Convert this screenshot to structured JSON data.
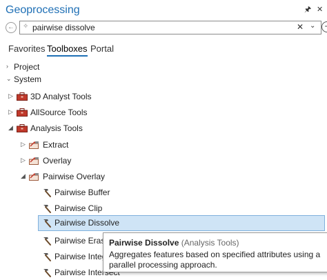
{
  "window": {
    "title": "Geoprocessing"
  },
  "search": {
    "value": "pairwise dissolve"
  },
  "tabs": [
    {
      "label": "Favorites"
    },
    {
      "label": "Toolboxes"
    },
    {
      "label": "Portal"
    }
  ],
  "tree": {
    "project": "Project",
    "system": "System",
    "toolboxes": [
      {
        "label": "3D Analyst Tools"
      },
      {
        "label": "AllSource Tools"
      },
      {
        "label": "Analysis Tools"
      }
    ],
    "toolsets": [
      {
        "label": "Extract"
      },
      {
        "label": "Overlay"
      },
      {
        "label": "Pairwise Overlay"
      }
    ],
    "tools": [
      {
        "label": "Pairwise Buffer"
      },
      {
        "label": "Pairwise Clip"
      },
      {
        "label": "Pairwise Dissolve"
      },
      {
        "label": "Pairwise Erase"
      },
      {
        "label": "Pairwise Integr"
      },
      {
        "label": "Pairwise Intersect"
      }
    ]
  },
  "tooltip": {
    "tool_name": "Pairwise Dissolve",
    "toolbox": "(Analysis Tools)",
    "description": "Aggregates features based on specified attributes using a parallel processing approach."
  },
  "colors": {
    "accent": "#1e6fb5",
    "selection": "#cfe4f6",
    "toolbox_red": "#c0392b"
  }
}
